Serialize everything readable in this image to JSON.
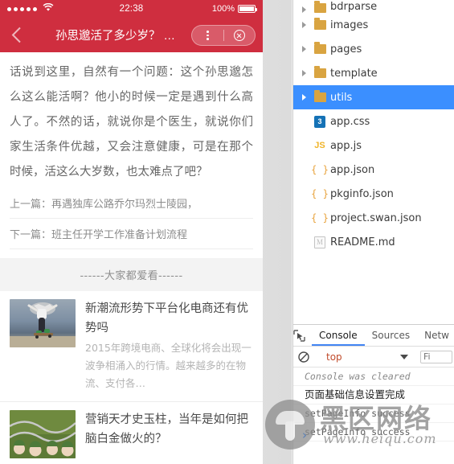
{
  "phone": {
    "status_bar": {
      "signal_dots": 5,
      "wifi_icon": "wifi-icon",
      "time": "22:38",
      "battery_percent": "100%",
      "battery_icon": "battery-full-icon"
    },
    "nav": {
      "back_icon": "chevron-left-icon",
      "title": "孙思邈活了多少岁？ …",
      "capsule": {
        "menu_icon": "more-vertical-icon",
        "close_icon": "close-circle-icon"
      }
    },
    "article": {
      "paragraph": "话说到这里，自然有一个问题：这个孙思邈怎么这么能活啊？他小的时候一定是遇到什么高人了。不然的话，就说你是个医生，就说你们家生活条件优越，又会注意健康，可是在那个时候，活这么大岁数，也太难点了吧？"
    },
    "pager": {
      "prev": "上一篇：再遇独库公路乔尔玛烈士陵园，",
      "next": "下一篇：班主任开学工作准备计划流程"
    },
    "hot_header": "------大家都爱看------",
    "recommendations": [
      {
        "title": "新潮流形势下平台化电商还有优势吗",
        "desc": "2015年跨境电商、全球化将会出现一波争相涌入的行情。越来越多的在物流、支付各…",
        "thumb": "skateboarder-photo"
      },
      {
        "title": "营销天才史玉柱，当年是如何把脑白金做火的？",
        "desc": "",
        "thumb": "field-figures-photo"
      }
    ]
  },
  "devtools": {
    "file_tree": [
      {
        "label": "bdrparse",
        "type": "folder",
        "selected": false,
        "clipped": true
      },
      {
        "label": "images",
        "type": "folder",
        "selected": false
      },
      {
        "label": "pages",
        "type": "folder",
        "selected": false
      },
      {
        "label": "template",
        "type": "folder",
        "selected": false
      },
      {
        "label": "utils",
        "type": "folder",
        "selected": true
      },
      {
        "label": "app.css",
        "type": "css",
        "icon": "css3-icon"
      },
      {
        "label": "app.js",
        "type": "js",
        "icon": "javascript-icon"
      },
      {
        "label": "app.json",
        "type": "json",
        "icon": "json-braces-icon"
      },
      {
        "label": "pkginfo.json",
        "type": "json",
        "icon": "json-braces-icon"
      },
      {
        "label": "project.swan.json",
        "type": "json",
        "icon": "json-braces-icon"
      },
      {
        "label": "README.md",
        "type": "md",
        "icon": "markdown-icon"
      }
    ],
    "tabs": [
      {
        "label": "Console",
        "active": true
      },
      {
        "label": "Sources",
        "active": false
      },
      {
        "label": "Netw",
        "active": false
      }
    ],
    "inspect_icon": "inspect-element-icon",
    "filter_bar": {
      "clear_icon": "clear-console-icon",
      "context": "top",
      "caret_icon": "chevron-down-icon",
      "filter_placeholder": "Fi"
    },
    "console_messages": [
      {
        "text": "Console was cleared",
        "style": "italic"
      },
      {
        "text": "页面基础信息设置完成",
        "style": "cn"
      },
      {
        "text": "setPageInfo success",
        "style": "normal"
      },
      {
        "text": "setPageInfo success",
        "style": "normal"
      }
    ]
  },
  "watermark": {
    "brand_cn": "黑区网络",
    "url": "www.heiqu.com",
    "logo": "mushroom-logo"
  },
  "colors": {
    "brand_red": "#cf2e3f",
    "selection_blue": "#3b8fff",
    "tab_underline": "#4285f4",
    "folder": "#d9a441"
  }
}
